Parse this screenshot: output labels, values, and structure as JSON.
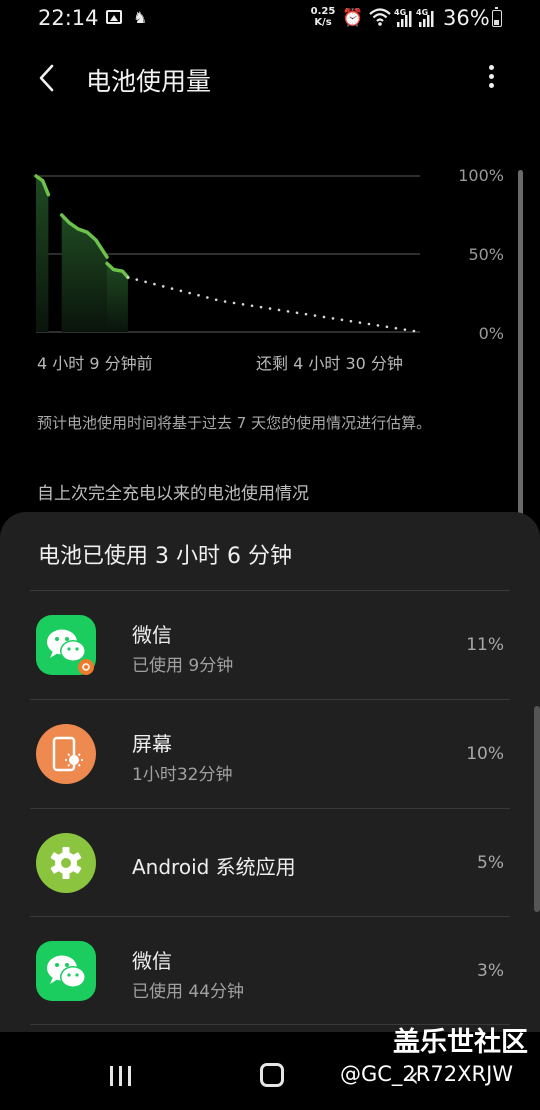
{
  "status_bar": {
    "time": "22:14",
    "net_speed_value": "0.25",
    "net_speed_unit": "K/s",
    "signal1": "4G",
    "signal2": "4G",
    "battery": "36%",
    "icons": [
      "gallery-icon",
      "app-notification-icon",
      "alarm-icon",
      "wifi-icon",
      "signal-icon",
      "battery-icon"
    ]
  },
  "header": {
    "title": "电池使用量"
  },
  "chart": {
    "y_labels": [
      "100%",
      "50%",
      "0%"
    ],
    "x_start": "4 小时 9 分钟前",
    "x_end": "还剩 4 小时 30 分钟"
  },
  "chart_data": {
    "type": "area",
    "ylim": [
      0,
      100
    ],
    "x_unit": "hours relative to now",
    "xlim": [
      -4.15,
      4.5
    ],
    "series": [
      {
        "name": "",
        "x": [
          -4.15,
          -4.0,
          -3.87
        ],
        "y": [
          100,
          97,
          88
        ]
      },
      {
        "name": "",
        "x": [
          -3.57,
          -3.4,
          -3.2,
          -3.0,
          -2.8,
          -2.55
        ],
        "y": [
          75,
          70,
          66,
          64,
          59,
          48
        ]
      },
      {
        "name": "",
        "x": [
          -2.55,
          -2.4,
          -2.2,
          -2.08
        ],
        "y": [
          44,
          40,
          39,
          35
        ]
      },
      {
        "name": "",
        "x": [
          -2.08,
          0,
          4.5
        ],
        "y": [
          35,
          20,
          0
        ],
        "projected": true
      }
    ],
    "colors": {
      "line": "#6cc24a",
      "fill": "#16321c",
      "projection": "#d8d8d8",
      "grid": "#4a4a4a"
    }
  },
  "note": "预计电池使用时间将基于过去 7 天您的使用情况进行估算。",
  "section_title": "自上次完全充电以来的电池使用情况",
  "usage": {
    "title": "电池已使用 3 小时 6 分钟",
    "apps": [
      {
        "name": "微信",
        "sub": "已使用 9分钟",
        "pct": "11%",
        "icon": "wechat-icon"
      },
      {
        "name": "屏幕",
        "sub": "1小时32分钟",
        "pct": "10%",
        "icon": "screen-icon"
      },
      {
        "name": "Android 系统应用",
        "sub": "",
        "pct": "5%",
        "icon": "gear-icon"
      },
      {
        "name": "微信",
        "sub": "已使用 44分钟",
        "pct": "3%",
        "icon": "wechat-icon"
      }
    ]
  },
  "watermark": {
    "title": "盖乐世社区",
    "handle": "@GC_2R72XRJW"
  }
}
